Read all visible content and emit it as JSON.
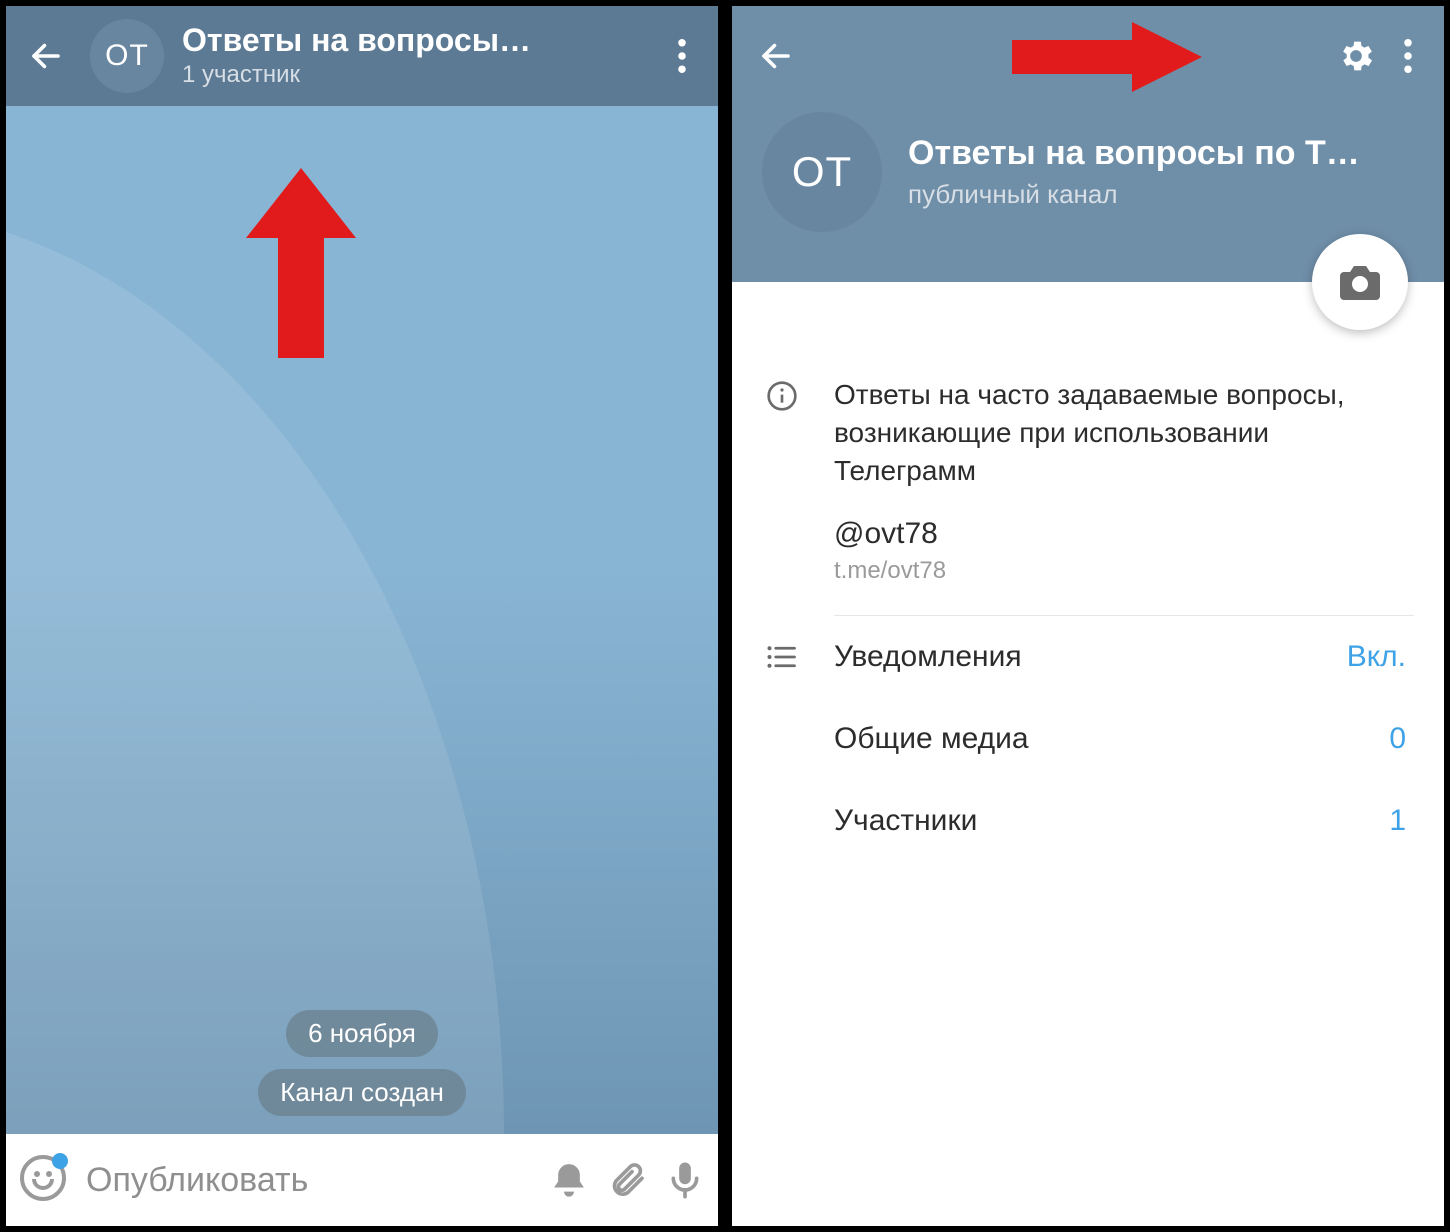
{
  "left": {
    "avatar_text": "ОТ",
    "title": "Ответы на вопросы…",
    "subtitle": "1 участник",
    "date_pill": "6 ноября",
    "status_pill": "Канал создан",
    "compose_placeholder": "Опубликовать"
  },
  "right": {
    "avatar_text": "ОТ",
    "title": "Ответы на вопросы по Т…",
    "subtitle": "публичный канал",
    "description": "Ответы на часто задаваемые вопросы, возникающие при использовании Телеграмм",
    "username": "@ovt78",
    "userlink": "t.me/ovt78",
    "rows": {
      "notifications_label": "Уведомления",
      "notifications_value": "Вкл.",
      "media_label": "Общие медиа",
      "media_value": "0",
      "members_label": "Участники",
      "members_value": "1"
    }
  },
  "colors": {
    "accent": "#3ea2e6",
    "annotation": "#e11b1b"
  }
}
